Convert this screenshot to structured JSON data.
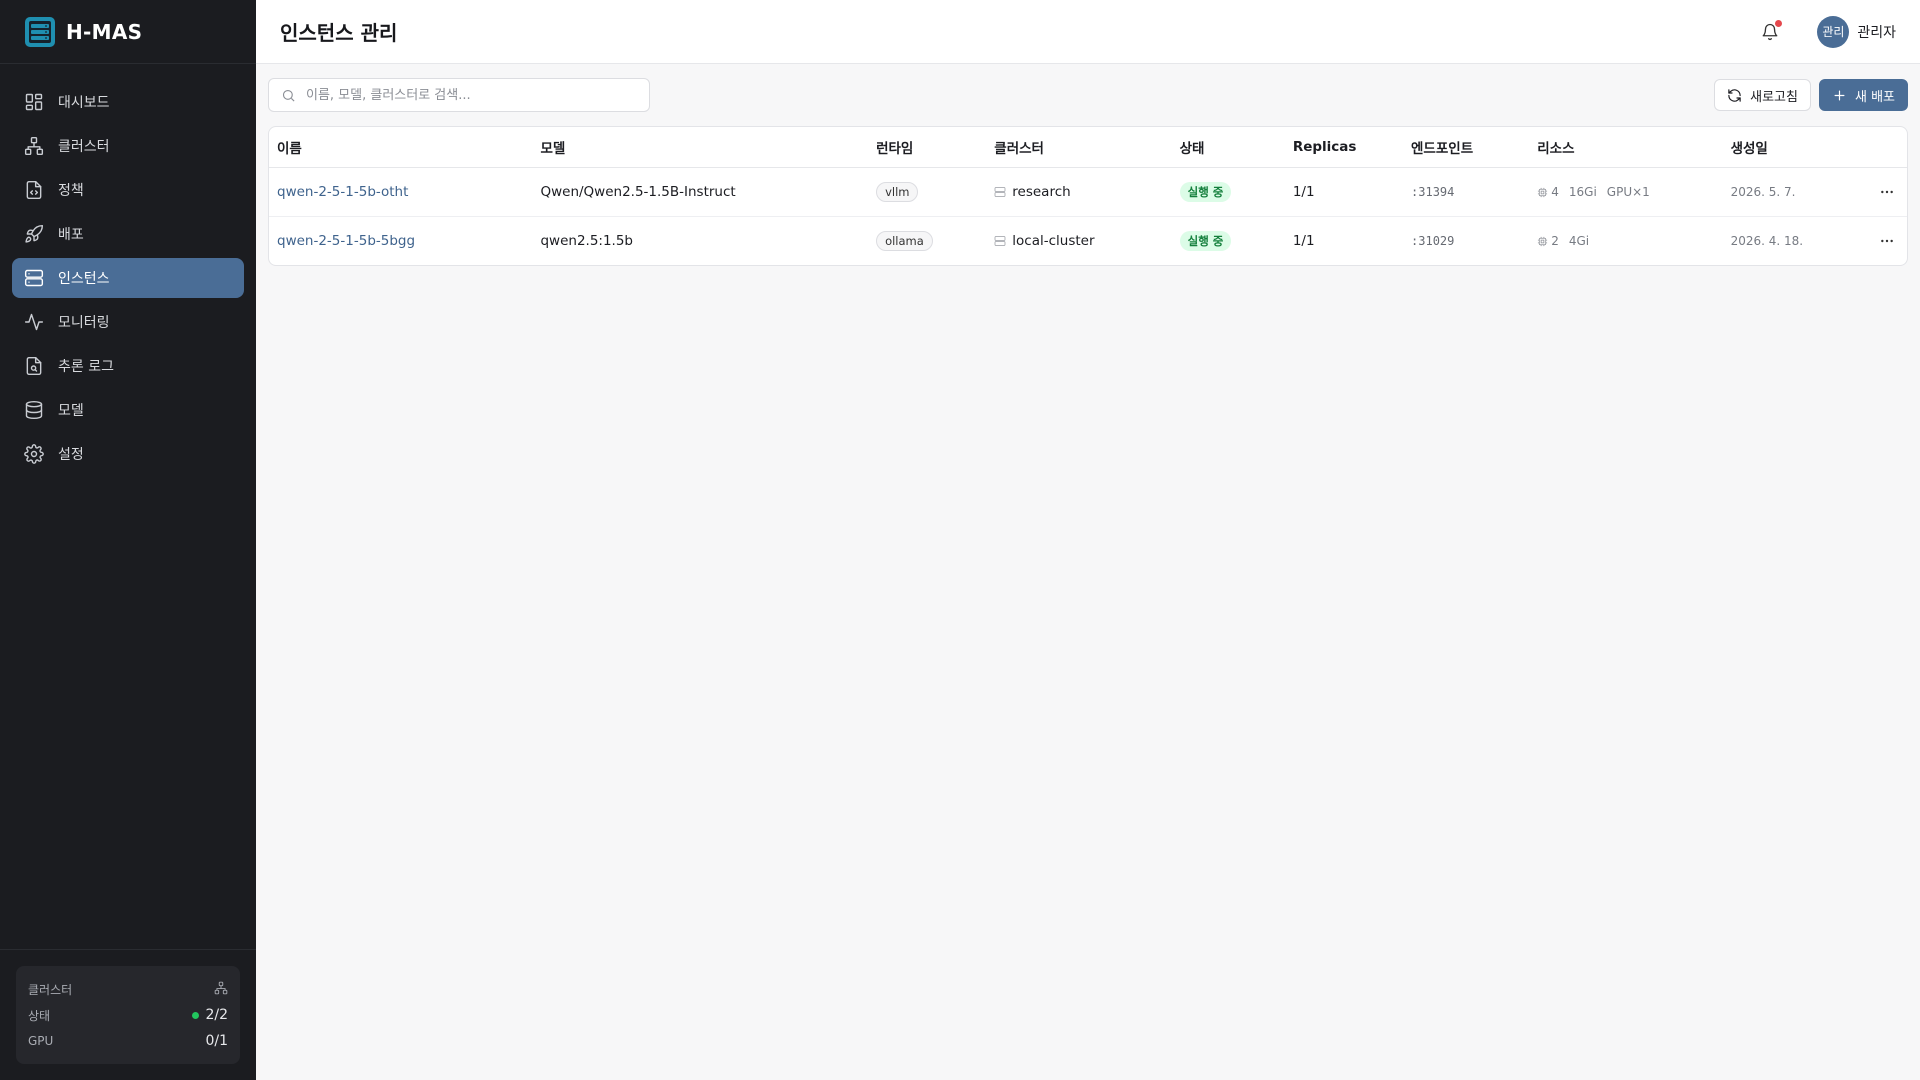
{
  "app": {
    "name": "H-MAS"
  },
  "sidebar": {
    "items": [
      {
        "label": "대시보드",
        "icon": "dashboard-icon",
        "active": false
      },
      {
        "label": "클러스터",
        "icon": "cluster-icon",
        "active": false
      },
      {
        "label": "정책",
        "icon": "policy-icon",
        "active": false
      },
      {
        "label": "배포",
        "icon": "rocket-icon",
        "active": false
      },
      {
        "label": "인스턴스",
        "icon": "server-icon",
        "active": true
      },
      {
        "label": "모니터링",
        "icon": "activity-icon",
        "active": false
      },
      {
        "label": "추론 로그",
        "icon": "log-icon",
        "active": false
      },
      {
        "label": "모델",
        "icon": "database-icon",
        "active": false
      },
      {
        "label": "설정",
        "icon": "gear-icon",
        "active": false
      }
    ],
    "cluster_card": {
      "title": "클러스터",
      "status_label": "상태",
      "status_value": "2/2",
      "gpu_label": "GPU",
      "gpu_value": "0/1"
    }
  },
  "header": {
    "title": "인스턴스 관리",
    "user_initials": "관리",
    "user_name": "관리자"
  },
  "toolbar": {
    "search_placeholder": "이름, 모델, 클러스터로 검색...",
    "refresh_label": "새로고침",
    "new_deploy_label": "새 배포"
  },
  "table": {
    "columns": {
      "name": "이름",
      "model": "모델",
      "runtime": "런타임",
      "cluster": "클러스터",
      "status": "상태",
      "replicas": "Replicas",
      "endpoint": "엔드포인트",
      "resources": "리소스",
      "created": "생성일"
    },
    "rows": [
      {
        "name": "qwen-2-5-1-5b-otht",
        "model": "Qwen/Qwen2.5-1.5B-Instruct",
        "runtime": "vllm",
        "cluster": "research",
        "status": "실행 중",
        "replicas": "1/1",
        "endpoint": ":31394",
        "cpu": "4",
        "memory": "16Gi",
        "gpu": "GPU×1",
        "created": "2026. 5. 7."
      },
      {
        "name": "qwen-2-5-1-5b-5bgg",
        "model": "qwen2.5:1.5b",
        "runtime": "ollama",
        "cluster": "local-cluster",
        "status": "실행 중",
        "replicas": "1/1",
        "endpoint": ":31029",
        "cpu": "2",
        "memory": "4Gi",
        "gpu": "",
        "created": "2026. 4. 18."
      }
    ]
  },
  "colors": {
    "sidebar_bg": "#1b1c20",
    "accent": "#4a6d96",
    "status_running_bg": "#dcfce7",
    "status_running_text": "#15803d",
    "notification_dot": "#e5484d"
  }
}
